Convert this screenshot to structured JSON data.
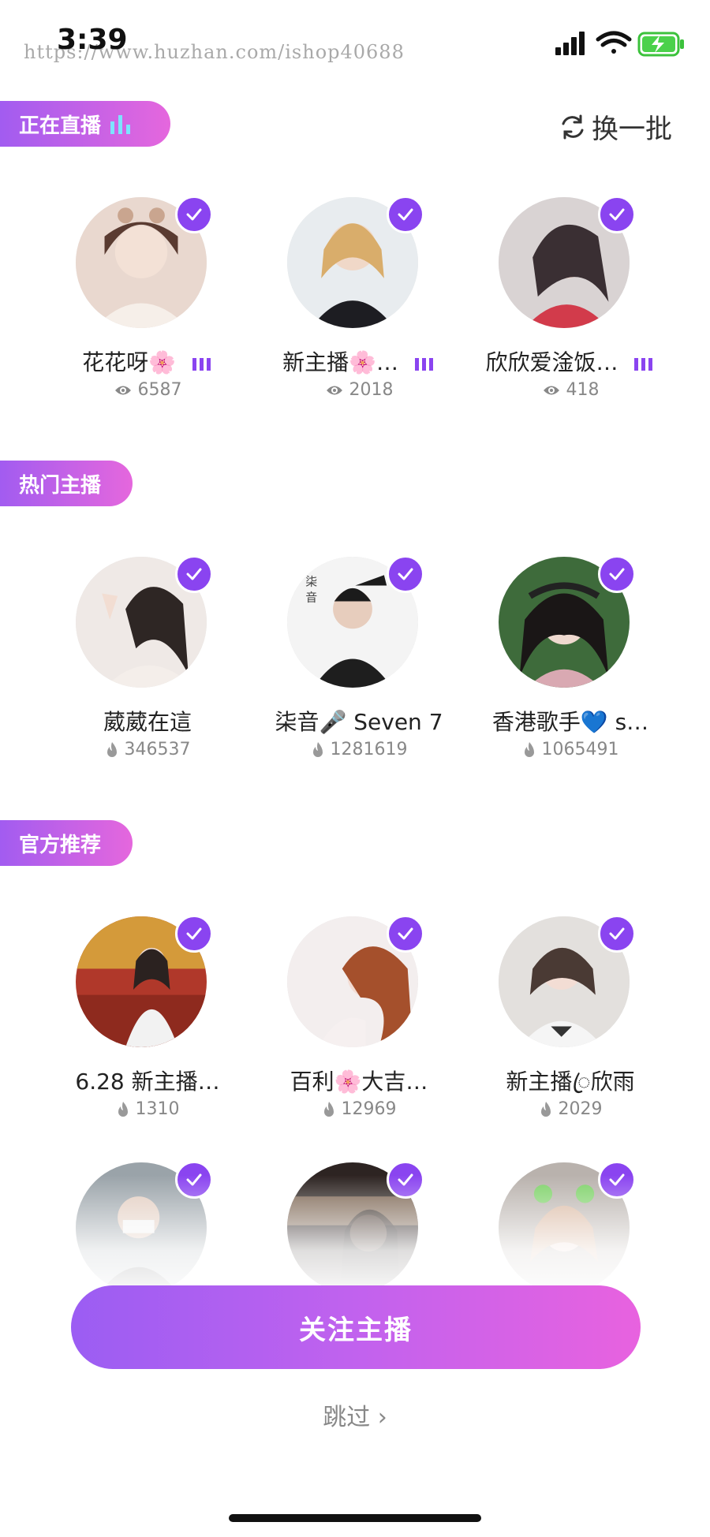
{
  "status_bar": {
    "time": "3:39",
    "watermark": "https://www.huzhan.com/ishop40688"
  },
  "sections": {
    "live": {
      "title": "正在直播",
      "refresh_label": "换一批"
    },
    "hot": {
      "title": "热门主播"
    },
    "official": {
      "title": "官方推荐"
    }
  },
  "live_hosts": [
    {
      "name": "花花呀🌸",
      "count": "6587"
    },
    {
      "name": "新主播🌸…",
      "count": "2018"
    },
    {
      "name": "欣欣爱淦饭…",
      "count": "418"
    }
  ],
  "hot_hosts": [
    {
      "name": "葳葳在這",
      "count": "346537"
    },
    {
      "name": "柒音🎤 Seven 7",
      "count": "1281619"
    },
    {
      "name": "香港歌手💙 s…",
      "count": "1065491"
    }
  ],
  "official_hosts": [
    {
      "name": "6.28 新主播…",
      "count": "1310"
    },
    {
      "name": "百利🌸大吉…",
      "count": "12969"
    },
    {
      "name": "新主播ꦿ欣雨",
      "count": "2029"
    }
  ],
  "footer": {
    "follow_label": "关注主播",
    "skip_label": "跳过 ›"
  },
  "colors": {
    "accent_start": "#a25cf0",
    "accent_end": "#e567dd",
    "check": "#8a44f0"
  }
}
